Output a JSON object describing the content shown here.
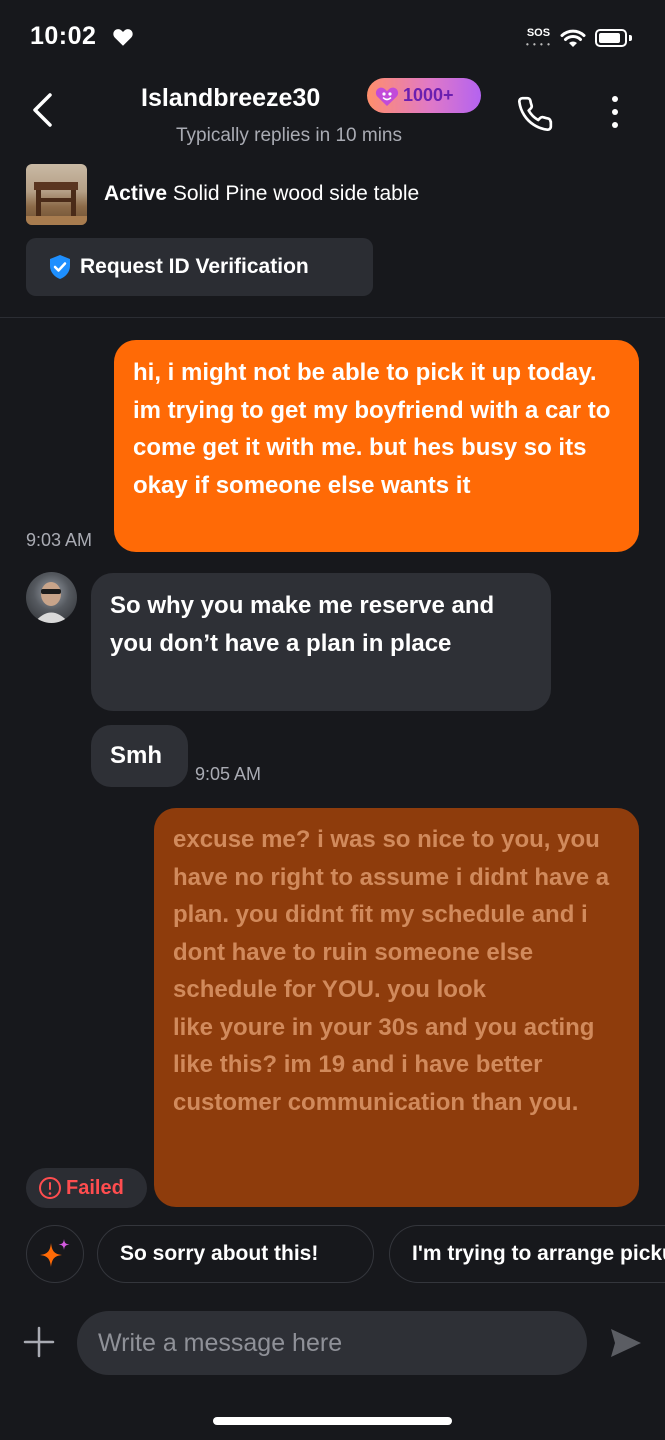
{
  "status_bar": {
    "time": "10:02",
    "sos": "SOS"
  },
  "header": {
    "username": "Islandbreeze30",
    "badge": "1000+",
    "reply_time": "Typically replies in 10 mins"
  },
  "listing": {
    "status": "Active",
    "title": "Solid Pine wood side table",
    "verify_label": "Request ID Verification"
  },
  "messages": [
    {
      "sender": "me",
      "text": "hi, i might not be able to pick it up today. im trying to get my boyfriend with a car to come get it with me. but hes busy so its okay if someone else wants it",
      "time": "9:03 AM"
    },
    {
      "sender": "them",
      "text": "So why you make me reserve and you don’t have a plan in place"
    },
    {
      "sender": "them",
      "text": "Smh",
      "time": "9:05 AM"
    },
    {
      "sender": "me",
      "text": "excuse me? i was so nice to you, you have no right to assume i didnt have a plan. you didnt fit my schedule and i dont have to ruin someone else schedule for YOU. you look\nlike youre in your 30s and you acting like this? im 19 and i have better customer communication than you.",
      "status": "Failed"
    }
  ],
  "quick_replies": [
    "So sorry about this!",
    "I'm trying to arrange pickup"
  ],
  "composer": {
    "placeholder": "Write a message here"
  },
  "colors": {
    "accent": "#ff6a06",
    "failed_bubble": "#8e3c0c",
    "failed_text": "#ff4d4f",
    "background": "#17181c"
  }
}
